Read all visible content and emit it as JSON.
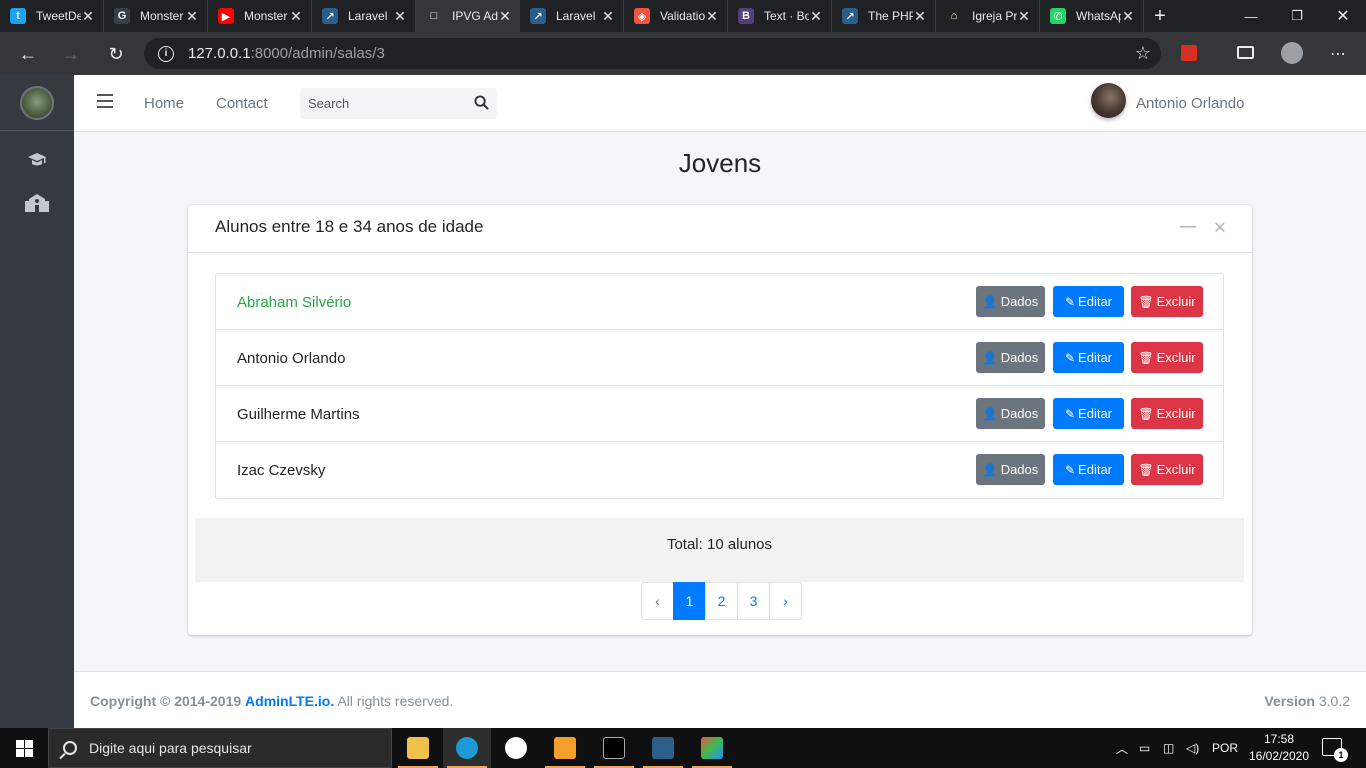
{
  "browser": {
    "tabs": [
      {
        "title": "TweetDeck",
        "icon": "twitter-icon",
        "color": "#1da1f2",
        "glyph": "t"
      },
      {
        "title": "Monster",
        "icon": "g-icon",
        "color": "#3a3f47",
        "glyph": "G"
      },
      {
        "title": "Monster",
        "icon": "youtube-icon",
        "color": "#ff0000",
        "glyph": "▶"
      },
      {
        "title": "Laravel",
        "icon": "laravel-icon",
        "color": "#2a5f8a",
        "glyph": "↗"
      },
      {
        "title": "IPVG Admin",
        "icon": "page-icon",
        "color": "#35363a",
        "glyph": "□"
      },
      {
        "title": "Laravel",
        "icon": "laravel-icon",
        "color": "#2a5f8a",
        "glyph": "↗"
      },
      {
        "title": "Validation",
        "icon": "laravel-icon",
        "color": "#f05340",
        "glyph": "◈"
      },
      {
        "title": "Text · Bootstrap",
        "icon": "bootstrap-icon",
        "color": "#563d7c",
        "glyph": "B"
      },
      {
        "title": "The PHP",
        "icon": "laravel-icon",
        "color": "#2a5f8a",
        "glyph": "↗"
      },
      {
        "title": "Igreja Presbiteriana",
        "icon": "church-icon",
        "color": "#222222",
        "glyph": "⌂"
      },
      {
        "title": "WhatsApp",
        "icon": "whatsapp-icon",
        "color": "#25d366",
        "glyph": "✆"
      }
    ],
    "active_tab": 4,
    "url_host": "127.0.0.1",
    "url_path": ":8000/admin/salas/3"
  },
  "navbar": {
    "home": "Home",
    "contact": "Contact",
    "search_placeholder": "Search",
    "user_name": "Antonio Orlando"
  },
  "page": {
    "title": "Jovens",
    "card_title": "Alunos entre 18 e 34 anos de idade",
    "students": [
      {
        "name": "Abraham Silvério",
        "highlight": true
      },
      {
        "name": "Antonio Orlando",
        "highlight": false
      },
      {
        "name": "Guilherme Martins",
        "highlight": false
      },
      {
        "name": "Izac Czevsky",
        "highlight": false
      }
    ],
    "buttons": {
      "dados": "Dados",
      "editar": "Editar",
      "excluir": "Excluir"
    },
    "total": "Total: 10 alunos",
    "pagination": {
      "prev": "‹",
      "pages": [
        "1",
        "2",
        "3"
      ],
      "next": "›",
      "active": "1"
    }
  },
  "footer": {
    "copyright_prefix": "Copyright © 2014-2019",
    "brand_link": "AdminLTE.io.",
    "rights": "All rights reserved.",
    "version_label": "Version",
    "version_value": "3.0.2"
  },
  "taskbar": {
    "search_placeholder": "Digite aqui para pesquisar",
    "language": "POR",
    "time": "17:58",
    "date": "16/02/2020",
    "notifications": "1"
  },
  "colors": {
    "sidebar": "#343a40",
    "primary": "#007bff",
    "secondary": "#6c757d",
    "danger": "#dc3545",
    "success": "#28a745"
  }
}
